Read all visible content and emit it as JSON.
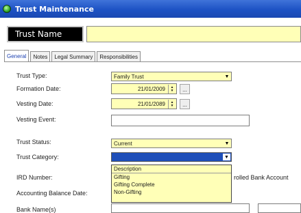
{
  "window": {
    "title": "Trust Maintenance"
  },
  "header": {
    "trust_name_label": "Trust Name",
    "trust_name_value": ""
  },
  "tabs": [
    {
      "label": "General",
      "active": true
    },
    {
      "label": "Notes",
      "active": false
    },
    {
      "label": "Legal Summary",
      "active": false
    },
    {
      "label": "Responsibilities",
      "active": false
    }
  ],
  "form": {
    "trust_type": {
      "label": "Trust Type:",
      "value": "Family Trust"
    },
    "formation_date": {
      "label": "Formation Date:",
      "value": "21/01/2009"
    },
    "vesting_date": {
      "label": "Vesting Date:",
      "value": "21/01/2089"
    },
    "vesting_event": {
      "label": "Vesting Event:",
      "value": ""
    },
    "trust_status": {
      "label": "Trust Status:",
      "value": "Current"
    },
    "trust_category": {
      "label": "Trust Category:",
      "value": "",
      "options": [
        "Description",
        "Gifting",
        "Gifting Complete",
        "Non-Gifting"
      ]
    },
    "ird_number": {
      "label": "IRD Number:"
    },
    "controlled_bank_account": {
      "label": "rolled Bank Account"
    },
    "accounting_balance_date": {
      "label": "Accounting Balance Date:"
    },
    "bank_names": {
      "label": "Bank Name(s)"
    }
  },
  "icons": {
    "app": "trust-app-icon",
    "combo_arrow": "▼",
    "spin_up": "▲",
    "spin_down": "▼",
    "ellipsis": "..."
  },
  "colors": {
    "titlebar": "#1d52c4",
    "field_yellow": "#ffffb7",
    "selection_blue": "#1f4fb9"
  }
}
